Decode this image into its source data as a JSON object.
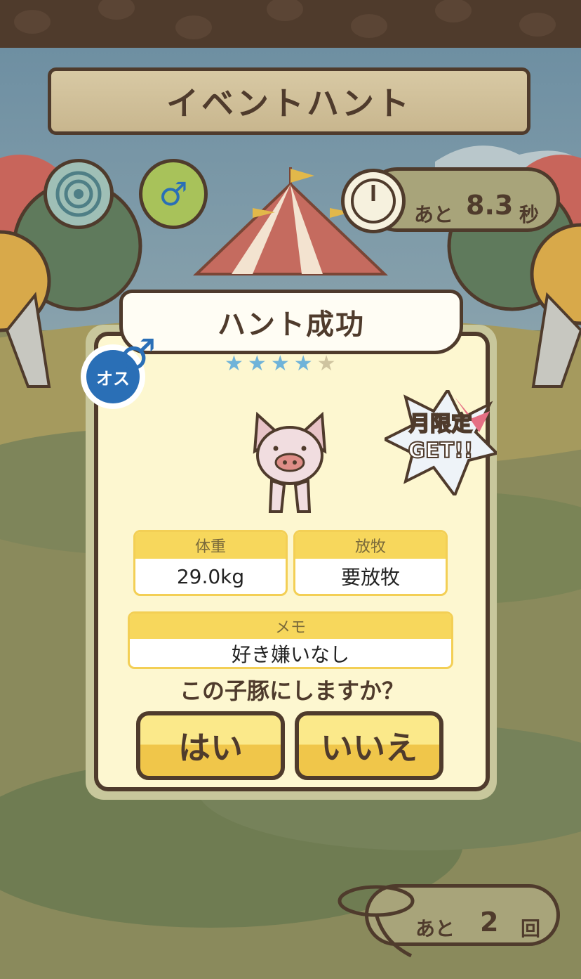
{
  "header": {
    "title": "イベントハント"
  },
  "timer": {
    "label": "あと",
    "value": "8.3",
    "unit": "秒"
  },
  "result": {
    "title": "ハント成功",
    "gender_badge": "オス",
    "stars_filled": 4,
    "stars_total": 5,
    "limited_badge": [
      "月限定",
      "GET!!"
    ],
    "stats": {
      "weight": {
        "label": "体重",
        "value": "29.0kg"
      },
      "pasture": {
        "label": "放牧",
        "value": "要放牧"
      },
      "memo": {
        "label": "メモ",
        "value": "好き嫌いなし"
      }
    },
    "question": "この子豚にしますか？",
    "yes_label": "はい",
    "no_label": "いいえ"
  },
  "remaining": {
    "label": "あと",
    "value": "2",
    "unit": "回"
  },
  "colors": {
    "frame": "#4f3b2c",
    "panel": "#fdf7d0",
    "accent_yellow": "#f7d75c",
    "male_blue": "#2a6fb6",
    "star_on": "#6fb3d9"
  }
}
